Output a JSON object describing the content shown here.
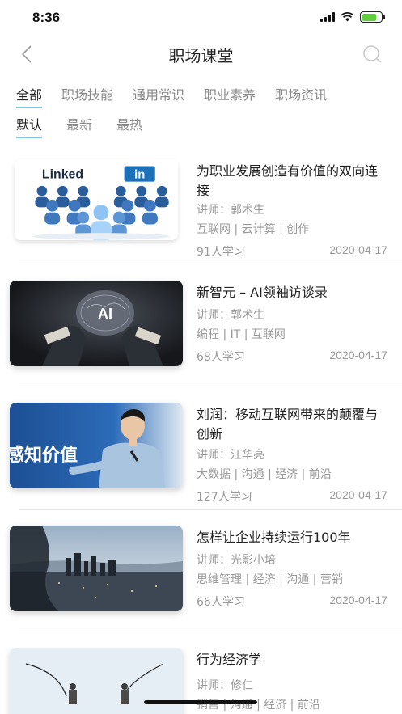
{
  "status_bar": {
    "time": "8:36"
  },
  "nav": {
    "title": "职场课堂"
  },
  "tabs": [
    {
      "label": "全部"
    },
    {
      "label": "职场技能"
    },
    {
      "label": "通用常识"
    },
    {
      "label": "职业素养"
    },
    {
      "label": "职场资讯"
    }
  ],
  "sort": [
    {
      "label": "默认"
    },
    {
      "label": "最新"
    },
    {
      "label": "最热"
    }
  ],
  "thumb_texts": {
    "linkedin": "Linked",
    "linkedin_in": "in",
    "ai": "AI",
    "banner": "感知价值"
  },
  "courses": [
    {
      "title": "为职业发展创造有价值的双向连接",
      "lecturer": "讲师：郭术生",
      "tags": "互联网 | 云计算 | 创作",
      "learners": "91人学习",
      "date": "2020-04-17"
    },
    {
      "title": "新智元 – AI领袖访谈录",
      "lecturer": "讲师：郭术生",
      "tags": "编程 | IT | 互联网",
      "learners": "68人学习",
      "date": "2020-04-17"
    },
    {
      "title": "刘润：移动互联网带来的颠覆与创新",
      "lecturer": "讲师：汪华亮",
      "tags": "大数据 | 沟通 | 经济 | 前沿",
      "learners": "127人学习",
      "date": "2020-04-17"
    },
    {
      "title": "怎样让企业持续运行100年",
      "lecturer": "讲师：光影小培",
      "tags": "思维管理 | 经济 | 沟通 | 营销",
      "learners": "66人学习",
      "date": "2020-04-17"
    },
    {
      "title": "行为经济学",
      "lecturer": "讲师：修仁",
      "tags": "销售 | 沟通 | 经济 | 前沿",
      "learners": "",
      "date": ""
    }
  ]
}
